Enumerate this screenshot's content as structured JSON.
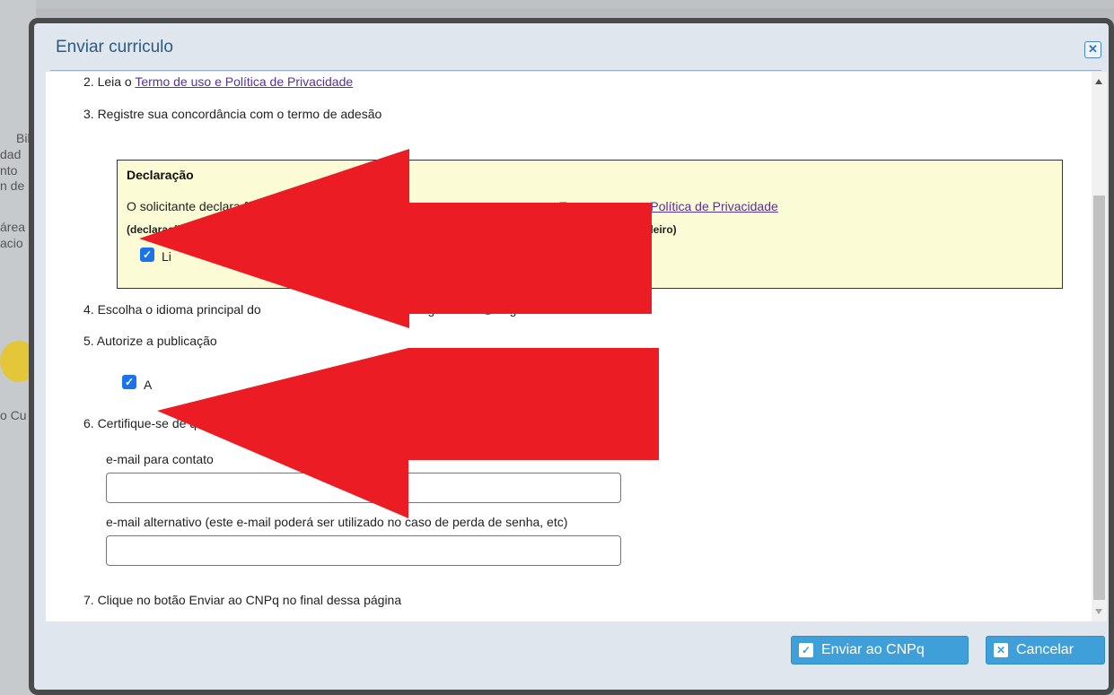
{
  "background": {
    "fragments": [
      "Bib",
      "dad",
      "nto",
      "n de",
      "área",
      "acio",
      "o Cu"
    ]
  },
  "dialog": {
    "title": "Enviar curriculo",
    "close_icon": "close-icon"
  },
  "steps": {
    "step2_prefix": "2. Leia o ",
    "step2_link": "Termo de uso e Política de Privacidade",
    "step3": "3. Registre sua concordância com o termo de adesão",
    "step4_left": "4. Escolha o idioma principal do",
    "step4_right": "Português",
    "step4_option2": "Inglês",
    "step5": "5. Autorize a publicação",
    "step6": "6. Certifique-se de que",
    "step7": "7. Clique no botão Enviar ao CNPq no final dessa página"
  },
  "declaration": {
    "title": "Declaração",
    "line1_left": "O solicitante declara f",
    "line1_link": "o e Política de Privacidade",
    "line1_link_left": "Te",
    "line2_left": "(declaração fe",
    "line2_right": "ileiro)",
    "checkbox_label": "Li",
    "checked": true
  },
  "publication": {
    "checkbox_label": "A",
    "checked": true
  },
  "fields": {
    "email_label": "e-mail para contato",
    "email_value": "",
    "alt_email_label": "e-mail alternativo (este e-mail poderá ser utilizado no caso de perda de senha, etc)",
    "alt_email_value": ""
  },
  "buttons": {
    "submit": "Enviar ao CNPq",
    "cancel": "Cancelar"
  },
  "colors": {
    "arrow": "#ec1c24",
    "button": "#3f9fd8",
    "title": "#2e5a82",
    "declaration_bg": "#fbfbd5"
  }
}
